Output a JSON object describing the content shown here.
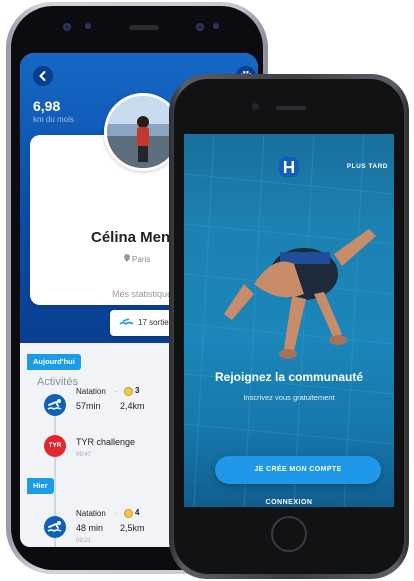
{
  "back_phone": {
    "distance": {
      "value": "6,98",
      "label": "km du mois"
    },
    "profile": {
      "name": "Célina Men",
      "city": "Paris"
    },
    "stats": {
      "title": "Mes statistique",
      "sessions": "17 sorties"
    },
    "activities": {
      "title": "Activités",
      "groups": [
        {
          "day": "Aujourd'hui",
          "items": [
            {
              "type": "swim",
              "sport": "Natation",
              "medals": "3",
              "duration": "57min",
              "distance": "2,4km"
            },
            {
              "type": "event",
              "logo": "TYR",
              "name": "TYR challenge",
              "time": "09:47"
            }
          ]
        },
        {
          "day": "Hier",
          "items": [
            {
              "type": "swim",
              "sport": "Natation",
              "medals": "4",
              "duration": "48 min",
              "distance": "2,5km",
              "time": "09:21"
            }
          ]
        }
      ]
    }
  },
  "front_phone": {
    "skip": "PLUS TARD",
    "headline": "Rejoignez la communauté",
    "subline": "Inscrivez vous gratuitement",
    "cta": "JE CRÉE MON COMPTE",
    "login": "CONNEXION"
  },
  "colors": {
    "brand_blue": "#0b4ba6",
    "accent_blue": "#1b9ce8",
    "tyr_red": "#e3262d",
    "pool_blue": "#1b86b9"
  }
}
